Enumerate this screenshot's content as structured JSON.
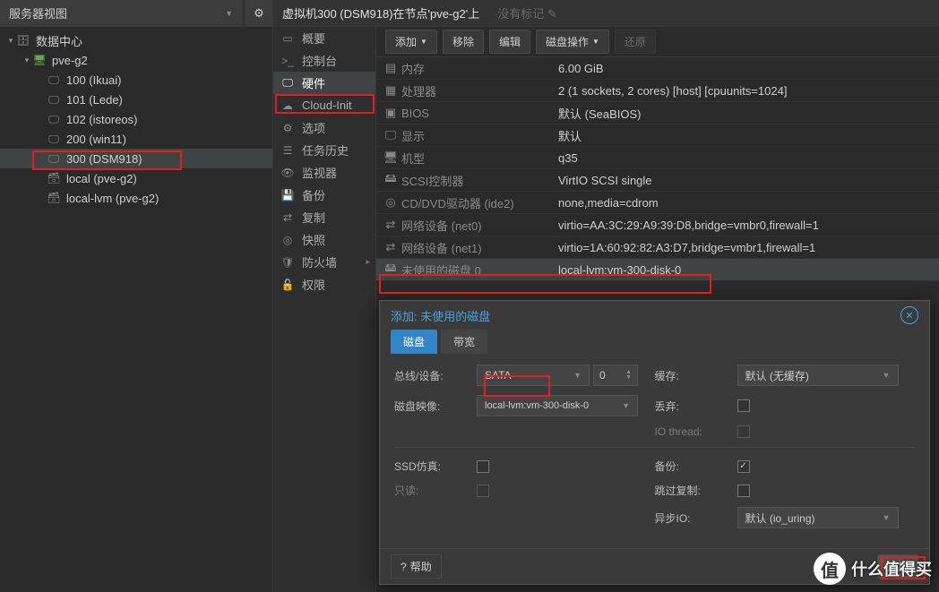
{
  "sidebar": {
    "view_label": "服务器视图",
    "nodes": {
      "datacenter": "数据中心",
      "node": "pve-g2",
      "vms": [
        {
          "id": "vm-100",
          "label": "100 (Ikuai)"
        },
        {
          "id": "vm-101",
          "label": "101 (Lede)"
        },
        {
          "id": "vm-102",
          "label": "102 (istoreos)"
        },
        {
          "id": "vm-200",
          "label": "200 (win11)"
        },
        {
          "id": "vm-300",
          "label": "300 (DSM918)"
        }
      ],
      "storage": [
        {
          "id": "local",
          "label": "local (pve-g2)"
        },
        {
          "id": "local-lvm",
          "label": "local-lvm (pve-g2)"
        }
      ]
    }
  },
  "header": {
    "title": "虚拟机300 (DSM918)在节点'pve-g2'上",
    "no_tags": "没有标记"
  },
  "submenu": [
    {
      "icon": "book",
      "label": "概要"
    },
    {
      "icon": "term",
      "label": "控制台"
    },
    {
      "icon": "mon",
      "label": "硬件",
      "active": true
    },
    {
      "icon": "cloud",
      "label": "Cloud-Init"
    },
    {
      "icon": "gear",
      "label": "选项"
    },
    {
      "icon": "list",
      "label": "任务历史"
    },
    {
      "icon": "eye",
      "label": "监视器"
    },
    {
      "icon": "save",
      "label": "备份"
    },
    {
      "icon": "sync",
      "label": "复制"
    },
    {
      "icon": "cam",
      "label": "快照"
    },
    {
      "icon": "shield",
      "label": "防火墙",
      "arrow": true
    },
    {
      "icon": "lock",
      "label": "权限"
    }
  ],
  "toolbar": {
    "add": "添加",
    "remove": "移除",
    "edit": "编辑",
    "disk_action": "磁盘操作",
    "revert": "还原"
  },
  "hardware": [
    {
      "icon": "mem",
      "label": "内存",
      "value": "6.00 GiB"
    },
    {
      "icon": "cpu",
      "label": "处理器",
      "value": "2 (1 sockets, 2 cores) [host] [cpuunits=1024]"
    },
    {
      "icon": "bios",
      "label": "BIOS",
      "value": "默认 (SeaBIOS)"
    },
    {
      "icon": "disp",
      "label": "显示",
      "value": "默认"
    },
    {
      "icon": "mach",
      "label": "机型",
      "value": "q35"
    },
    {
      "icon": "scsi",
      "label": "SCSI控制器",
      "value": "VirtIO SCSI single"
    },
    {
      "icon": "cd",
      "label": "CD/DVD驱动器 (ide2)",
      "value": "none,media=cdrom"
    },
    {
      "icon": "net",
      "label": "网络设备 (net0)",
      "value": "virtio=AA:3C:29:A9:39:D8,bridge=vmbr0,firewall=1"
    },
    {
      "icon": "net",
      "label": "网络设备 (net1)",
      "value": "virtio=1A:60:92:82:A3:D7,bridge=vmbr1,firewall=1"
    },
    {
      "icon": "hdd",
      "label": "未使用的磁盘 0",
      "value": "local-lvm:vm-300-disk-0",
      "selected": true
    }
  ],
  "dialog": {
    "title": "添加: 未使用的磁盘",
    "tabs": {
      "disk": "磁盘",
      "bandwidth": "带宽"
    },
    "labels": {
      "bus": "总线/设备:",
      "bus_val": "SATA",
      "bus_num": "0",
      "image": "磁盘映像:",
      "image_val": "local-lvm:vm-300-disk-0",
      "cache": "缓存:",
      "cache_val": "默认 (无缓存)",
      "discard": "丢弃:",
      "iothread": "IO thread:",
      "ssd": "SSD仿真:",
      "readonly": "只读:",
      "backup": "备份:",
      "skiprepl": "跳过复制:",
      "asyncio": "异步IO:",
      "asyncio_val": "默认 (io_uring)"
    },
    "help": "帮助",
    "add_btn": "添加"
  },
  "watermark": "什么值得买"
}
